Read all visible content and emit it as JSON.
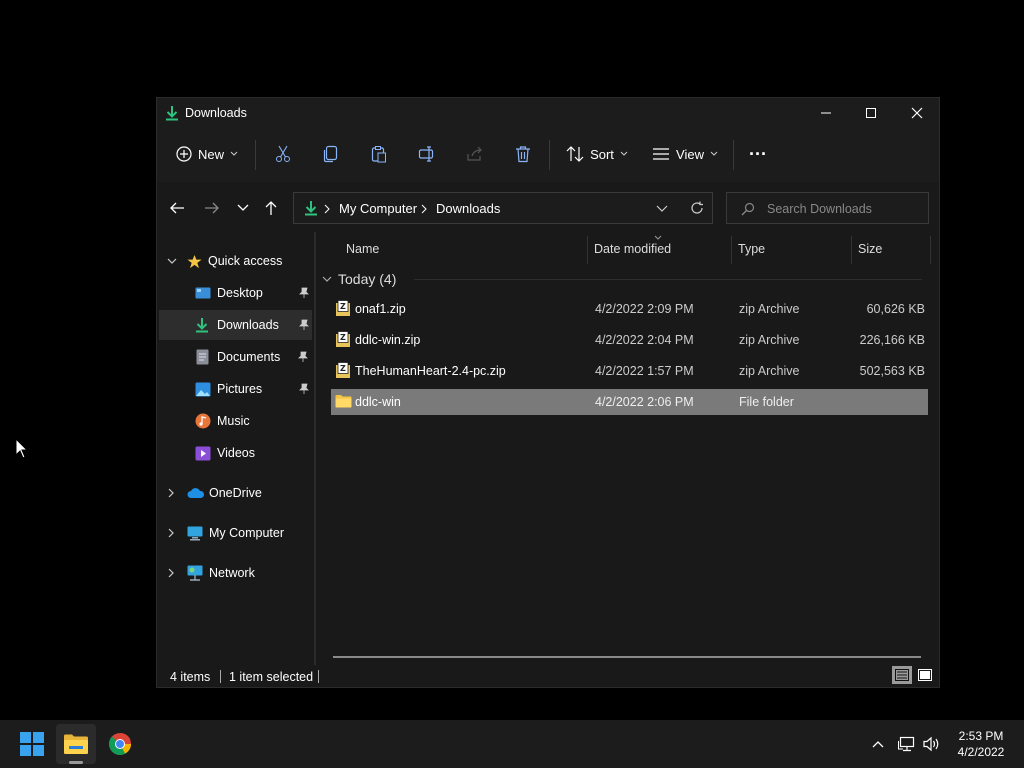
{
  "window": {
    "title": "Downloads"
  },
  "commandbar": {
    "new_label": "New",
    "sort_label": "Sort",
    "view_label": "View",
    "more_label": "···"
  },
  "address": {
    "crumbs": [
      "My Computer",
      "Downloads"
    ],
    "search_placeholder": "Search Downloads"
  },
  "sidebar": {
    "quick_access": "Quick access",
    "pinned": [
      {
        "label": "Desktop",
        "icon": "desktop-icon",
        "pinned": true
      },
      {
        "label": "Downloads",
        "icon": "download-icon",
        "pinned": true,
        "selected": true
      },
      {
        "label": "Documents",
        "icon": "documents-icon",
        "pinned": true
      },
      {
        "label": "Pictures",
        "icon": "pictures-icon",
        "pinned": true
      },
      {
        "label": "Music",
        "icon": "music-icon",
        "pinned": false
      },
      {
        "label": "Videos",
        "icon": "videos-icon",
        "pinned": false
      }
    ],
    "roots": [
      {
        "label": "OneDrive",
        "icon": "cloud-icon"
      },
      {
        "label": "My Computer",
        "icon": "computer-icon"
      },
      {
        "label": "Network",
        "icon": "network-icon"
      }
    ]
  },
  "columns": {
    "name": "Name",
    "date": "Date modified",
    "type": "Type",
    "size": "Size"
  },
  "group": {
    "label": "Today (4)"
  },
  "files": [
    {
      "name": "onaf1.zip",
      "date": "4/2/2022 2:09 PM",
      "type": "zip Archive",
      "size": "60,626 KB",
      "icon": "zip-icon"
    },
    {
      "name": "ddlc-win.zip",
      "date": "4/2/2022 2:04 PM",
      "type": "zip Archive",
      "size": "226,166 KB",
      "icon": "zip-icon"
    },
    {
      "name": "TheHumanHeart-2.4-pc.zip",
      "date": "4/2/2022 1:57 PM",
      "type": "zip Archive",
      "size": "502,563 KB",
      "icon": "zip-icon"
    },
    {
      "name": "ddlc-win",
      "date": "4/2/2022 2:06 PM",
      "type": "File folder",
      "size": "",
      "icon": "folder-icon",
      "selected": true
    }
  ],
  "status": {
    "items": "4 items",
    "selected": "1 item selected"
  },
  "clock": {
    "time": "2:53 PM",
    "date": "4/2/2022"
  },
  "colors": {
    "accent": "#2ec27e",
    "selection": "#7a7a7a",
    "folder": "#f4c542"
  }
}
